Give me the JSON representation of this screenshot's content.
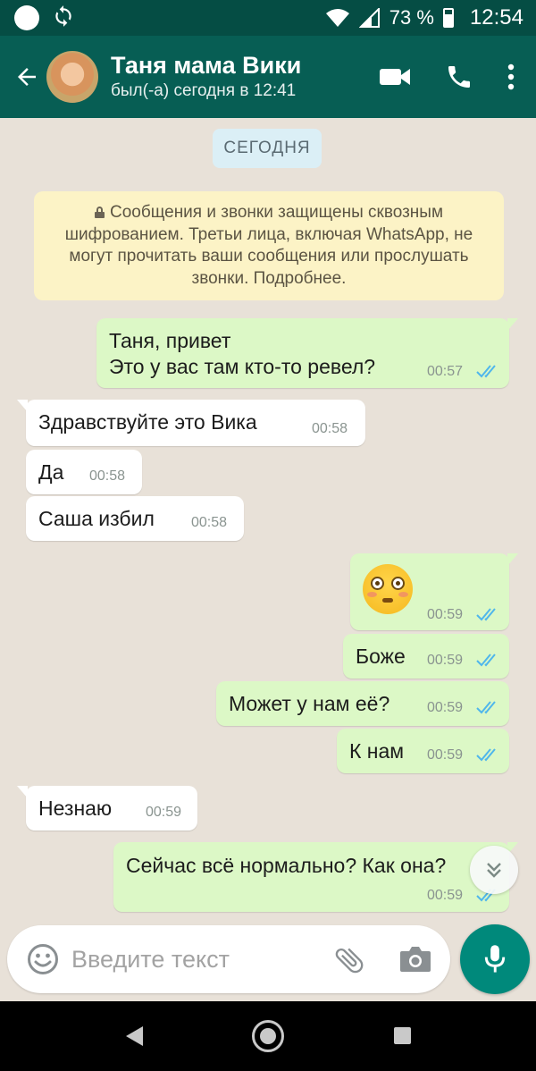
{
  "status_bar": {
    "battery": "73 %",
    "time": "12:54"
  },
  "header": {
    "contact_name": "Таня мама Вики",
    "last_seen": "был(-а) сегодня в 12:41"
  },
  "chat": {
    "date_label": "СЕГОДНЯ",
    "encryption_notice": "Сообщения и звонки защищены сквозным шифрованием. Третьи лица, включая WhatsApp, не могут прочитать ваши сообщения или прослушать звонки. Подробнее.",
    "messages": [
      {
        "direction": "out",
        "text": "Таня, привет\nЭто у вас там кто-то ревел?",
        "time": "00:57",
        "read": true
      },
      {
        "direction": "in",
        "text": "Здравствуйте это Вика",
        "time": "00:58"
      },
      {
        "direction": "in",
        "text": "Да",
        "time": "00:58"
      },
      {
        "direction": "in",
        "text": "Саша избил",
        "time": "00:58"
      },
      {
        "direction": "out",
        "emoji": "flushed-face",
        "time": "00:59",
        "read": true
      },
      {
        "direction": "out",
        "text": "Боже",
        "time": "00:59",
        "read": true
      },
      {
        "direction": "out",
        "text": "Может у нам её?",
        "time": "00:59",
        "read": true
      },
      {
        "direction": "out",
        "text": "К нам",
        "time": "00:59",
        "read": true
      },
      {
        "direction": "in",
        "text": "Незнаю",
        "time": "00:59"
      },
      {
        "direction": "out",
        "text": "Сейчас всё нормально? Как она?",
        "time": "00:59",
        "read": true
      }
    ]
  },
  "composer": {
    "placeholder": "Введите текст"
  },
  "colors": {
    "status_bar": "#054d44",
    "app_bar": "#075e54",
    "chat_bg": "#e8e1d8",
    "bubble_out": "#dcf8c6",
    "bubble_in": "#ffffff",
    "read_ticks": "#4fb6ec",
    "fab": "#00897b"
  }
}
